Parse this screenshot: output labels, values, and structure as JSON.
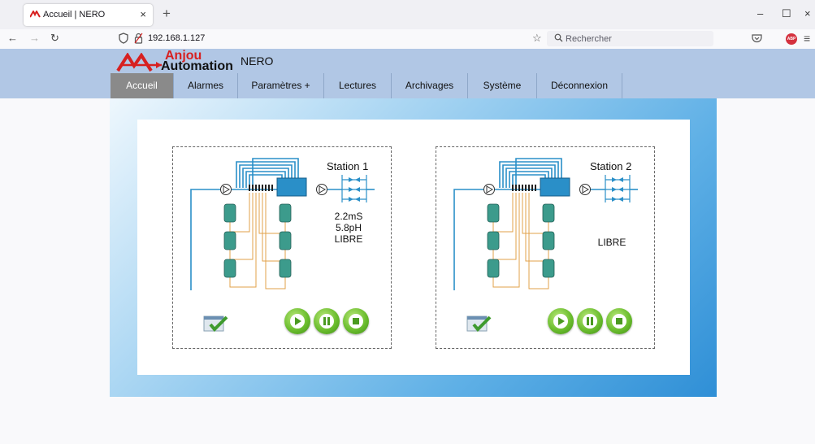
{
  "browser": {
    "tab_title": "Accueil | NERO",
    "tab_close": "×",
    "new_tab": "+",
    "url": "192.168.1.127",
    "search_placeholder": "Rechercher",
    "win_min": "–",
    "win_max": "☐",
    "win_close": "×",
    "back": "←",
    "forward": "→",
    "reload": "↻",
    "star": "☆",
    "menu": "≡",
    "abp_label": "ABP",
    "icons": [
      "shield-icon",
      "lock-icon",
      "search-icon",
      "pocket-icon",
      "adblock-icon",
      "hamburger-menu-icon"
    ]
  },
  "header": {
    "logo_line1": "Anjou",
    "logo_line2": "Automation",
    "app_title": "NERO",
    "brand_color": "#d72020",
    "header_bg": "#b1c7e5"
  },
  "menu": {
    "items": [
      {
        "label": "Accueil",
        "active": true
      },
      {
        "label": "Alarmes"
      },
      {
        "label": "Paramètres +"
      },
      {
        "label": "Lectures"
      },
      {
        "label": "Archivages"
      },
      {
        "label": "Système"
      },
      {
        "label": "Déconnexion"
      }
    ]
  },
  "stations": [
    {
      "title": "Station 1",
      "conductivity": "2.2mS",
      "ph": "5.8pH",
      "status": "LIBRE"
    },
    {
      "title": "Station 2",
      "status": "LIBRE"
    }
  ],
  "colors": {
    "pipe": "#2a8fc8",
    "tank": "#3c9b8c",
    "wire": "#e2a24a",
    "button": "#6cbe2f"
  }
}
